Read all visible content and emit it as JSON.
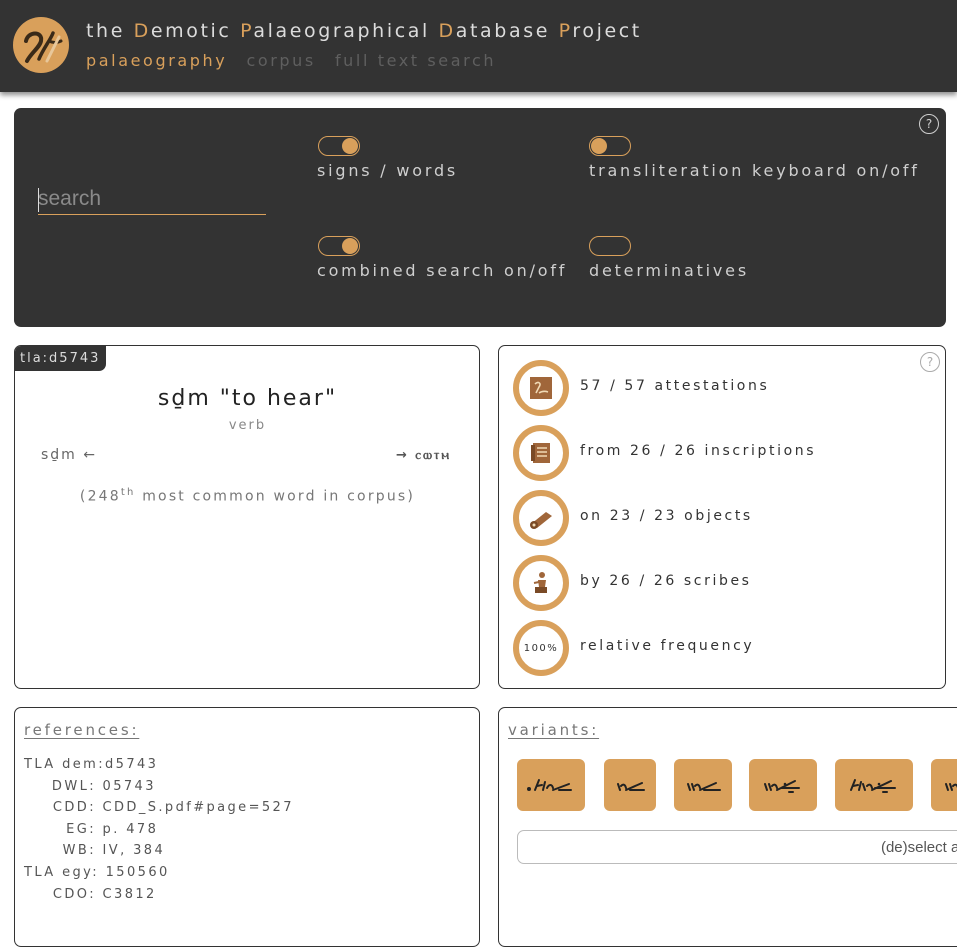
{
  "header": {
    "title_parts": [
      {
        "text": "the ",
        "cap": false
      },
      {
        "text": "D",
        "cap": true
      },
      {
        "text": "emotic ",
        "cap": false
      },
      {
        "text": "P",
        "cap": true
      },
      {
        "text": "alaeographical ",
        "cap": false
      },
      {
        "text": "D",
        "cap": true
      },
      {
        "text": "atabase ",
        "cap": false
      },
      {
        "text": "P",
        "cap": true
      },
      {
        "text": "roject",
        "cap": false
      }
    ],
    "nav": [
      {
        "label": "palaeography",
        "active": true
      },
      {
        "label": "corpus",
        "active": false
      },
      {
        "label": "full text search",
        "active": false
      }
    ]
  },
  "search": {
    "placeholder": "search",
    "help": "?",
    "toggles": [
      {
        "label": "signs / words",
        "on": true
      },
      {
        "label": "transliteration keyboard on/off",
        "on": false
      },
      {
        "label": "combined search on/off",
        "on": true
      },
      {
        "label": "determinatives",
        "on": null
      }
    ]
  },
  "word": {
    "id": "tla:d5743",
    "lemma": "sḏm \"to hear\"",
    "pos": "verb",
    "prev": "sḏm ←",
    "next": "→ ⲥⲱⲧⲙ",
    "rank_prefix": "(248",
    "rank_sup": "th",
    "rank_suffix": " most common word in corpus)"
  },
  "stats": {
    "help": "?",
    "items": [
      {
        "icon": "attestation-icon",
        "label": "57 / 57 attestations"
      },
      {
        "icon": "inscription-icon",
        "label": "from 26 / 26 inscriptions"
      },
      {
        "icon": "scroll-object-icon",
        "label": "on 23 / 23 objects"
      },
      {
        "icon": "scribe-icon",
        "label": "by 26 / 26 scribes"
      },
      {
        "icon": "frequency-ring",
        "label": "relative frequency",
        "percent": "100%"
      }
    ]
  },
  "references": {
    "title": "references:",
    "rows": [
      {
        "key": "TLA dem:",
        "value": "d5743"
      },
      {
        "key": "DWL:",
        "value": "05743"
      },
      {
        "key": "CDD:",
        "value": "CDD_S.pdf#page=527"
      },
      {
        "key": "EG:",
        "value": "p. 478"
      },
      {
        "key": "WB:",
        "value": "IV, 384"
      },
      {
        "key": "TLA egy:",
        "value": "150560"
      },
      {
        "key": "CDO:",
        "value": "C3812"
      }
    ]
  },
  "variants": {
    "title": "variants:",
    "deselect_label": "(de)select all",
    "items": [
      {
        "glyph": "variant-glyph-1"
      },
      {
        "glyph": "variant-glyph-2"
      },
      {
        "glyph": "variant-glyph-3"
      },
      {
        "glyph": "variant-glyph-4"
      },
      {
        "glyph": "variant-glyph-5"
      },
      {
        "glyph": "variant-glyph-6"
      }
    ]
  },
  "colors": {
    "accent": "#d9a05b",
    "panel": "#333333"
  }
}
